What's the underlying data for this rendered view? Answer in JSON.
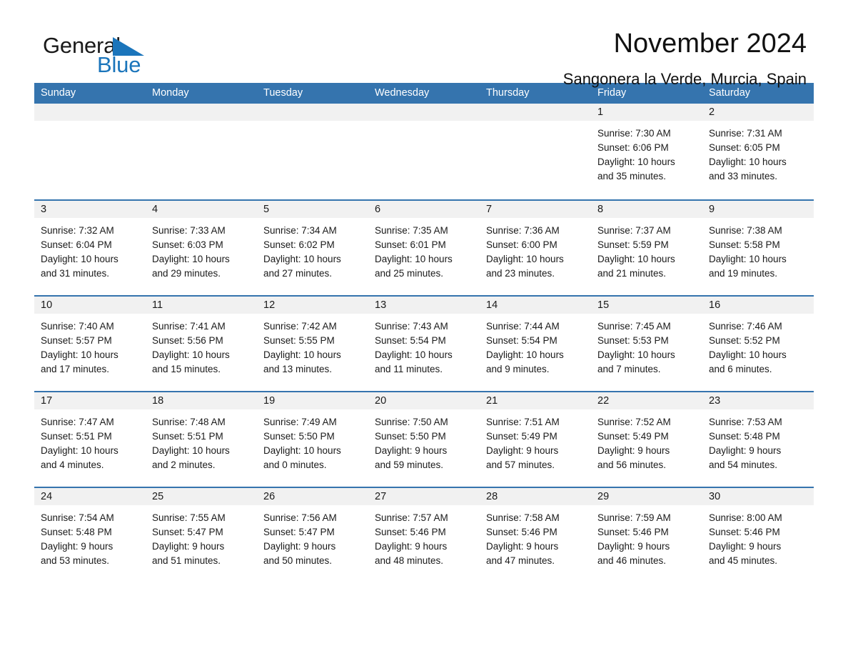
{
  "brand": {
    "word_one": "General",
    "word_two": "Blue",
    "triangle_icon": "brand-triangle-icon",
    "accent_color": "#1b75bb"
  },
  "header": {
    "month_title": "November 2024",
    "location": "Sangonera la Verde, Murcia, Spain"
  },
  "theme": {
    "header_blue": "#3574ae",
    "day_band_gray": "#f1f1f1",
    "text_color": "#1a1a1a"
  },
  "weekdays": [
    "Sunday",
    "Monday",
    "Tuesday",
    "Wednesday",
    "Thursday",
    "Friday",
    "Saturday"
  ],
  "weeks": [
    [
      {
        "date": "",
        "empty": true,
        "lines": []
      },
      {
        "date": "",
        "empty": true,
        "lines": []
      },
      {
        "date": "",
        "empty": true,
        "lines": []
      },
      {
        "date": "",
        "empty": true,
        "lines": []
      },
      {
        "date": "",
        "empty": true,
        "lines": []
      },
      {
        "date": "1",
        "empty": false,
        "lines": [
          "Sunrise: 7:30 AM",
          "Sunset: 6:06 PM",
          "Daylight: 10 hours",
          "and 35 minutes."
        ]
      },
      {
        "date": "2",
        "empty": false,
        "lines": [
          "Sunrise: 7:31 AM",
          "Sunset: 6:05 PM",
          "Daylight: 10 hours",
          "and 33 minutes."
        ]
      }
    ],
    [
      {
        "date": "3",
        "empty": false,
        "lines": [
          "Sunrise: 7:32 AM",
          "Sunset: 6:04 PM",
          "Daylight: 10 hours",
          "and 31 minutes."
        ]
      },
      {
        "date": "4",
        "empty": false,
        "lines": [
          "Sunrise: 7:33 AM",
          "Sunset: 6:03 PM",
          "Daylight: 10 hours",
          "and 29 minutes."
        ]
      },
      {
        "date": "5",
        "empty": false,
        "lines": [
          "Sunrise: 7:34 AM",
          "Sunset: 6:02 PM",
          "Daylight: 10 hours",
          "and 27 minutes."
        ]
      },
      {
        "date": "6",
        "empty": false,
        "lines": [
          "Sunrise: 7:35 AM",
          "Sunset: 6:01 PM",
          "Daylight: 10 hours",
          "and 25 minutes."
        ]
      },
      {
        "date": "7",
        "empty": false,
        "lines": [
          "Sunrise: 7:36 AM",
          "Sunset: 6:00 PM",
          "Daylight: 10 hours",
          "and 23 minutes."
        ]
      },
      {
        "date": "8",
        "empty": false,
        "lines": [
          "Sunrise: 7:37 AM",
          "Sunset: 5:59 PM",
          "Daylight: 10 hours",
          "and 21 minutes."
        ]
      },
      {
        "date": "9",
        "empty": false,
        "lines": [
          "Sunrise: 7:38 AM",
          "Sunset: 5:58 PM",
          "Daylight: 10 hours",
          "and 19 minutes."
        ]
      }
    ],
    [
      {
        "date": "10",
        "empty": false,
        "lines": [
          "Sunrise: 7:40 AM",
          "Sunset: 5:57 PM",
          "Daylight: 10 hours",
          "and 17 minutes."
        ]
      },
      {
        "date": "11",
        "empty": false,
        "lines": [
          "Sunrise: 7:41 AM",
          "Sunset: 5:56 PM",
          "Daylight: 10 hours",
          "and 15 minutes."
        ]
      },
      {
        "date": "12",
        "empty": false,
        "lines": [
          "Sunrise: 7:42 AM",
          "Sunset: 5:55 PM",
          "Daylight: 10 hours",
          "and 13 minutes."
        ]
      },
      {
        "date": "13",
        "empty": false,
        "lines": [
          "Sunrise: 7:43 AM",
          "Sunset: 5:54 PM",
          "Daylight: 10 hours",
          "and 11 minutes."
        ]
      },
      {
        "date": "14",
        "empty": false,
        "lines": [
          "Sunrise: 7:44 AM",
          "Sunset: 5:54 PM",
          "Daylight: 10 hours",
          "and 9 minutes."
        ]
      },
      {
        "date": "15",
        "empty": false,
        "lines": [
          "Sunrise: 7:45 AM",
          "Sunset: 5:53 PM",
          "Daylight: 10 hours",
          "and 7 minutes."
        ]
      },
      {
        "date": "16",
        "empty": false,
        "lines": [
          "Sunrise: 7:46 AM",
          "Sunset: 5:52 PM",
          "Daylight: 10 hours",
          "and 6 minutes."
        ]
      }
    ],
    [
      {
        "date": "17",
        "empty": false,
        "lines": [
          "Sunrise: 7:47 AM",
          "Sunset: 5:51 PM",
          "Daylight: 10 hours",
          "and 4 minutes."
        ]
      },
      {
        "date": "18",
        "empty": false,
        "lines": [
          "Sunrise: 7:48 AM",
          "Sunset: 5:51 PM",
          "Daylight: 10 hours",
          "and 2 minutes."
        ]
      },
      {
        "date": "19",
        "empty": false,
        "lines": [
          "Sunrise: 7:49 AM",
          "Sunset: 5:50 PM",
          "Daylight: 10 hours",
          "and 0 minutes."
        ]
      },
      {
        "date": "20",
        "empty": false,
        "lines": [
          "Sunrise: 7:50 AM",
          "Sunset: 5:50 PM",
          "Daylight: 9 hours",
          "and 59 minutes."
        ]
      },
      {
        "date": "21",
        "empty": false,
        "lines": [
          "Sunrise: 7:51 AM",
          "Sunset: 5:49 PM",
          "Daylight: 9 hours",
          "and 57 minutes."
        ]
      },
      {
        "date": "22",
        "empty": false,
        "lines": [
          "Sunrise: 7:52 AM",
          "Sunset: 5:49 PM",
          "Daylight: 9 hours",
          "and 56 minutes."
        ]
      },
      {
        "date": "23",
        "empty": false,
        "lines": [
          "Sunrise: 7:53 AM",
          "Sunset: 5:48 PM",
          "Daylight: 9 hours",
          "and 54 minutes."
        ]
      }
    ],
    [
      {
        "date": "24",
        "empty": false,
        "lines": [
          "Sunrise: 7:54 AM",
          "Sunset: 5:48 PM",
          "Daylight: 9 hours",
          "and 53 minutes."
        ]
      },
      {
        "date": "25",
        "empty": false,
        "lines": [
          "Sunrise: 7:55 AM",
          "Sunset: 5:47 PM",
          "Daylight: 9 hours",
          "and 51 minutes."
        ]
      },
      {
        "date": "26",
        "empty": false,
        "lines": [
          "Sunrise: 7:56 AM",
          "Sunset: 5:47 PM",
          "Daylight: 9 hours",
          "and 50 minutes."
        ]
      },
      {
        "date": "27",
        "empty": false,
        "lines": [
          "Sunrise: 7:57 AM",
          "Sunset: 5:46 PM",
          "Daylight: 9 hours",
          "and 48 minutes."
        ]
      },
      {
        "date": "28",
        "empty": false,
        "lines": [
          "Sunrise: 7:58 AM",
          "Sunset: 5:46 PM",
          "Daylight: 9 hours",
          "and 47 minutes."
        ]
      },
      {
        "date": "29",
        "empty": false,
        "lines": [
          "Sunrise: 7:59 AM",
          "Sunset: 5:46 PM",
          "Daylight: 9 hours",
          "and 46 minutes."
        ]
      },
      {
        "date": "30",
        "empty": false,
        "lines": [
          "Sunrise: 8:00 AM",
          "Sunset: 5:46 PM",
          "Daylight: 9 hours",
          "and 45 minutes."
        ]
      }
    ]
  ]
}
